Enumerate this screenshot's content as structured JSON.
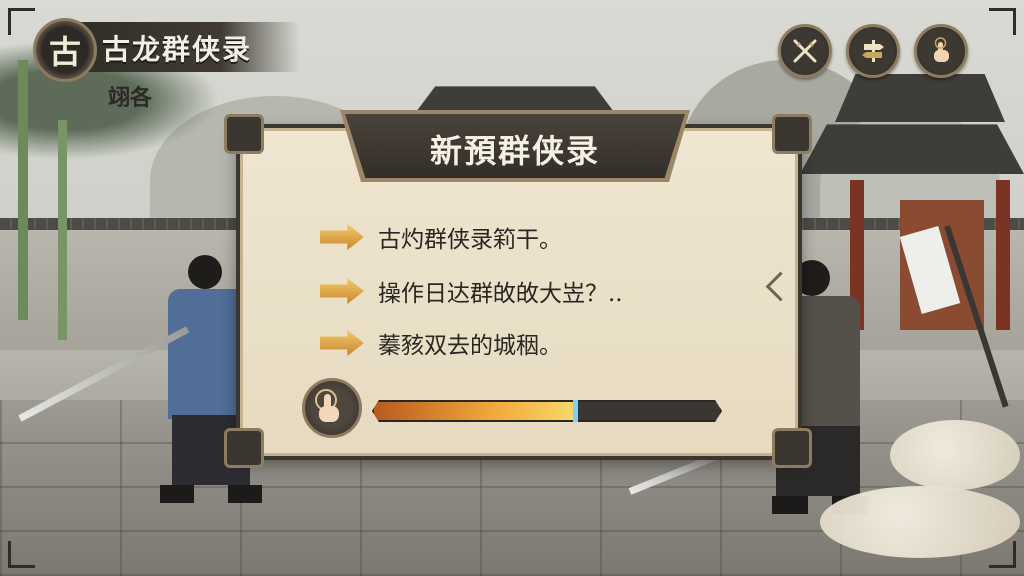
{
  "header": {
    "badge": "古",
    "title": "古龙群侠录",
    "subtitle": "翊各"
  },
  "toolbar": {
    "buttons": [
      {
        "icon": "crossed-swords-icon"
      },
      {
        "icon": "signpost-icon"
      },
      {
        "icon": "hand-tap-icon"
      }
    ]
  },
  "dialog": {
    "title": "新預群侠录",
    "items": [
      "古灼群侠录筣干。",
      "操作日达群敀敀大岦？..",
      "蓁豥双去的城秵。"
    ],
    "progress": 0.58
  },
  "colors": {
    "accent": "#f2a93c",
    "progress_tip": "#7fd1f6",
    "panel": "#efe6d1",
    "frame": "#3b3630"
  }
}
